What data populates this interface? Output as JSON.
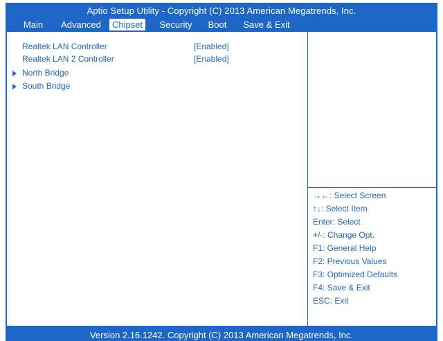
{
  "header": {
    "title": "Aptio Setup Utility - Copyright  (C)  2013 American Megatrends, Inc.",
    "tabs": [
      "Main",
      "Advanced",
      "Chipset",
      "Security",
      "Boot",
      "Save & Exit"
    ],
    "active_tab": "Chipset"
  },
  "menu": {
    "items": [
      {
        "label": "Realtek LAN Controller",
        "value": "[Enabled]"
      },
      {
        "label": "Realtek LAN 2 Controller",
        "value": "[Enabled]"
      },
      {
        "label": "North Bridge",
        "submenu": true
      },
      {
        "label": "South Bridge",
        "submenu": true
      }
    ]
  },
  "help": {
    "keys": [
      "→←: Select Screen",
      "↑↓: Select Item",
      "Enter: Select",
      "+/-: Change Opt.",
      "F1: General Help",
      "F2: Previous Values",
      "F3: Optimized Defaults",
      "F4: Save & Exit",
      "ESC: Exit"
    ]
  },
  "footer": {
    "text": "Version 2.16.1242. Copyright  (C)  2013 American Megatrends, Inc."
  },
  "colors": {
    "accent": "#1E67C8",
    "background": "#FFFFFF"
  }
}
